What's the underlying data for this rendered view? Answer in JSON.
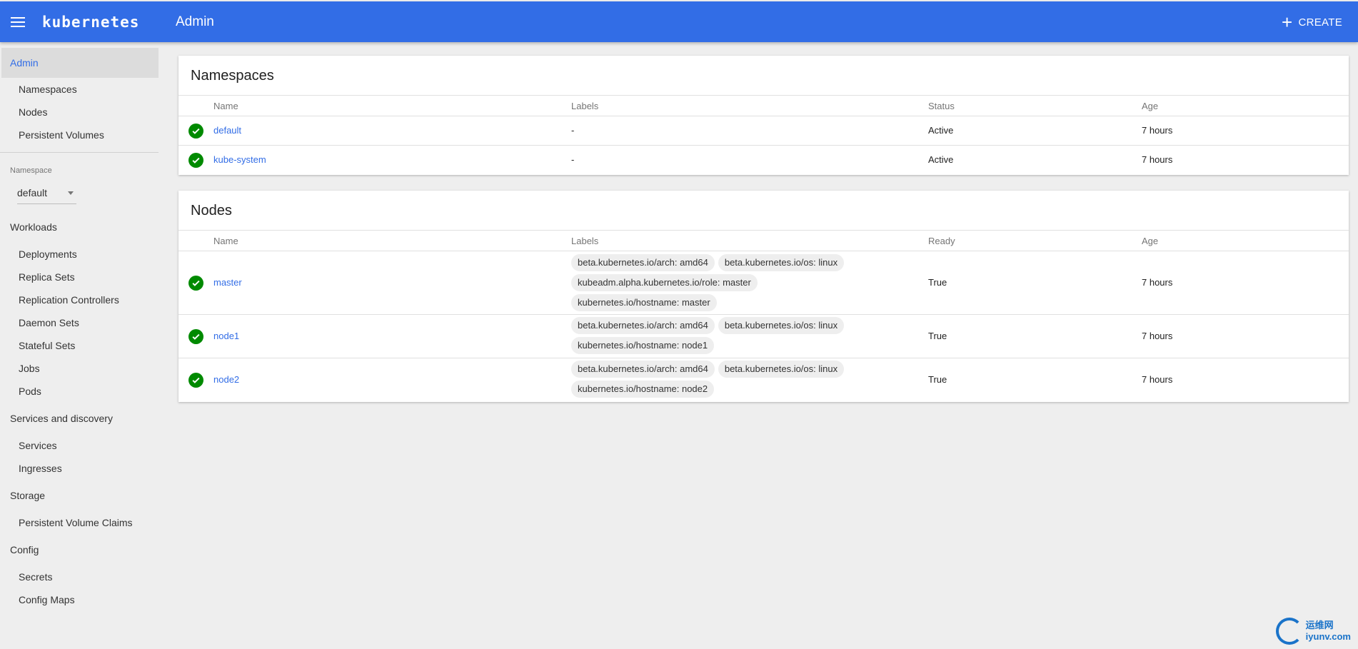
{
  "header": {
    "brand": "kubernetes",
    "title": "Admin",
    "create_label": "CREATE"
  },
  "sidebar": {
    "admin": "Admin",
    "admin_items": [
      "Namespaces",
      "Nodes",
      "Persistent Volumes"
    ],
    "namespace_label": "Namespace",
    "namespace_value": "default",
    "sections": {
      "workloads": "Workloads",
      "workload_items": [
        "Deployments",
        "Replica Sets",
        "Replication Controllers",
        "Daemon Sets",
        "Stateful Sets",
        "Jobs",
        "Pods"
      ],
      "services": "Services and discovery",
      "service_items": [
        "Services",
        "Ingresses"
      ],
      "storage": "Storage",
      "storage_items": [
        "Persistent Volume Claims"
      ],
      "config": "Config",
      "config_items": [
        "Secrets",
        "Config Maps"
      ]
    }
  },
  "namespaces": {
    "title": "Namespaces",
    "columns": [
      "Name",
      "Labels",
      "Status",
      "Age"
    ],
    "rows": [
      {
        "name": "default",
        "labels": "-",
        "status": "Active",
        "age": "7 hours"
      },
      {
        "name": "kube-system",
        "labels": "-",
        "status": "Active",
        "age": "7 hours"
      }
    ]
  },
  "nodes": {
    "title": "Nodes",
    "columns": [
      "Name",
      "Labels",
      "Ready",
      "Age"
    ],
    "rows": [
      {
        "name": "master",
        "labels": [
          "beta.kubernetes.io/arch: amd64",
          "beta.kubernetes.io/os: linux",
          "kubeadm.alpha.kubernetes.io/role: master",
          "kubernetes.io/hostname: master"
        ],
        "ready": "True",
        "age": "7 hours"
      },
      {
        "name": "node1",
        "labels": [
          "beta.kubernetes.io/arch: amd64",
          "beta.kubernetes.io/os: linux",
          "kubernetes.io/hostname: node1"
        ],
        "ready": "True",
        "age": "7 hours"
      },
      {
        "name": "node2",
        "labels": [
          "beta.kubernetes.io/arch: amd64",
          "beta.kubernetes.io/os: linux",
          "kubernetes.io/hostname: node2"
        ],
        "ready": "True",
        "age": "7 hours"
      }
    ]
  },
  "watermark": {
    "line1": "运维网",
    "line2": "iyunv.com"
  }
}
